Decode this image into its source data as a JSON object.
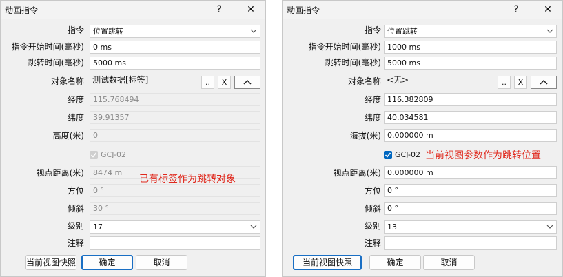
{
  "left": {
    "title": "动画指令",
    "help": "?",
    "close": "✕",
    "command_label": "指令",
    "command_value": "位置跳转",
    "start_time_label": "指令开始时间(毫秒)",
    "start_time_value": "0 ms",
    "jump_time_label": "跳转时间(毫秒)",
    "jump_time_value": "5000 ms",
    "object_label": "对象名称",
    "object_value": "测试数据[标签]",
    "browse_btn": "..",
    "clear_btn": "X",
    "lon_label": "经度",
    "lon_value": "115.768494",
    "lat_label": "纬度",
    "lat_value": "39.91357",
    "height_label": "高度(米)",
    "height_value": "0",
    "gcj_label": "GCJ-02",
    "view_dist_label": "视点距离(米)",
    "view_dist_value": "8474 m",
    "azimuth_label": "方位",
    "azimuth_value": "0 °",
    "tilt_label": "倾斜",
    "tilt_value": "30 °",
    "level_label": "级别",
    "level_value": "17",
    "note_label": "注释",
    "note_value": "",
    "snapshot_btn": "当前视图快照",
    "ok_btn": "确定",
    "cancel_btn": "取消",
    "annotation": "已有标签作为跳转对象"
  },
  "right": {
    "title": "动画指令",
    "help": "?",
    "close": "✕",
    "command_label": "指令",
    "command_value": "位置跳转",
    "start_time_label": "指令开始时间(毫秒)",
    "start_time_value": "1000 ms",
    "jump_time_label": "跳转时间(毫秒)",
    "jump_time_value": "5000 ms",
    "object_label": "对象名称",
    "object_value": "<无>",
    "browse_btn": "..",
    "clear_btn": "X",
    "lon_label": "经度",
    "lon_value": "116.382809",
    "lat_label": "纬度",
    "lat_value": "40.034581",
    "alt_label": "海拔(米)",
    "alt_value": "0.000000 m",
    "gcj_label": "GCJ-02",
    "view_dist_label": "视点距离(米)",
    "view_dist_value": "0.000000 m",
    "azimuth_label": "方位",
    "azimuth_value": "0 °",
    "tilt_label": "倾斜",
    "tilt_value": "0 °",
    "level_label": "级别",
    "level_value": "13",
    "note_label": "注释",
    "note_value": "",
    "snapshot_btn": "当前视图快照",
    "ok_btn": "确定",
    "cancel_btn": "取消",
    "annotation": "当前视图参数作为跳转位置"
  },
  "colors": {
    "accent": "#0067c0",
    "annotation": "#e0281c",
    "dialog_bg": "#f0f0f0"
  }
}
